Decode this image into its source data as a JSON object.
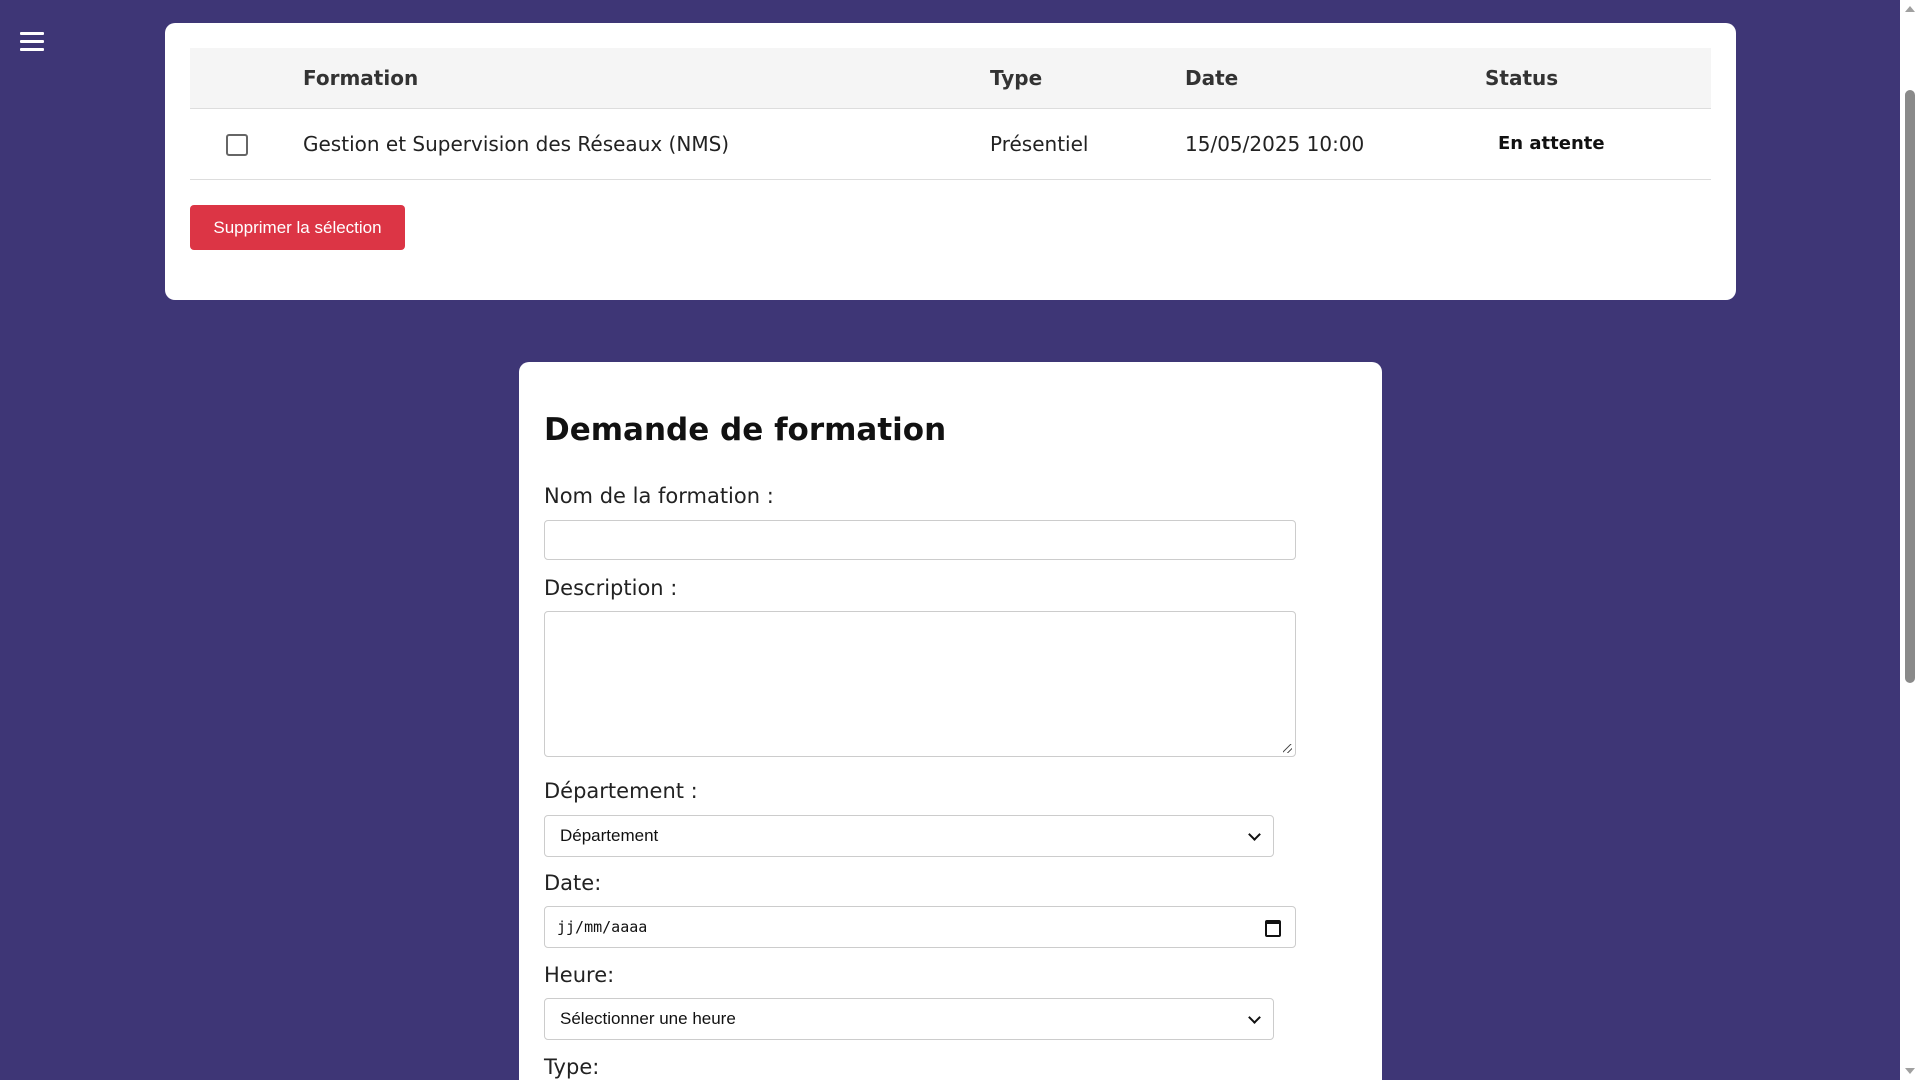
{
  "colors": {
    "page_background": "#3e3676",
    "card_background": "#ffffff",
    "delete_button": "#dc3545"
  },
  "nav": {
    "menu_icon": "hamburger-menu-icon"
  },
  "table": {
    "headers": {
      "formation": "Formation",
      "type": "Type",
      "date": "Date",
      "status": "Status"
    },
    "rows": [
      {
        "selected": false,
        "formation": "Gestion et Supervision des Réseaux (NMS)",
        "type": "Présentiel",
        "date": "15/05/2025 10:00",
        "status": "En attente"
      }
    ],
    "delete_label": "Supprimer la sélection"
  },
  "form": {
    "title": "Demande de formation",
    "name_label": "Nom de la formation :",
    "name_value": "",
    "description_label": "Description :",
    "description_value": "",
    "department_label": "Département :",
    "department_selected": "Département",
    "date_label": "Date:",
    "date_placeholder": "jj/mm/aaaa",
    "hour_label": "Heure:",
    "hour_selected": "Sélectionner une heure",
    "type_label": "Type:"
  }
}
